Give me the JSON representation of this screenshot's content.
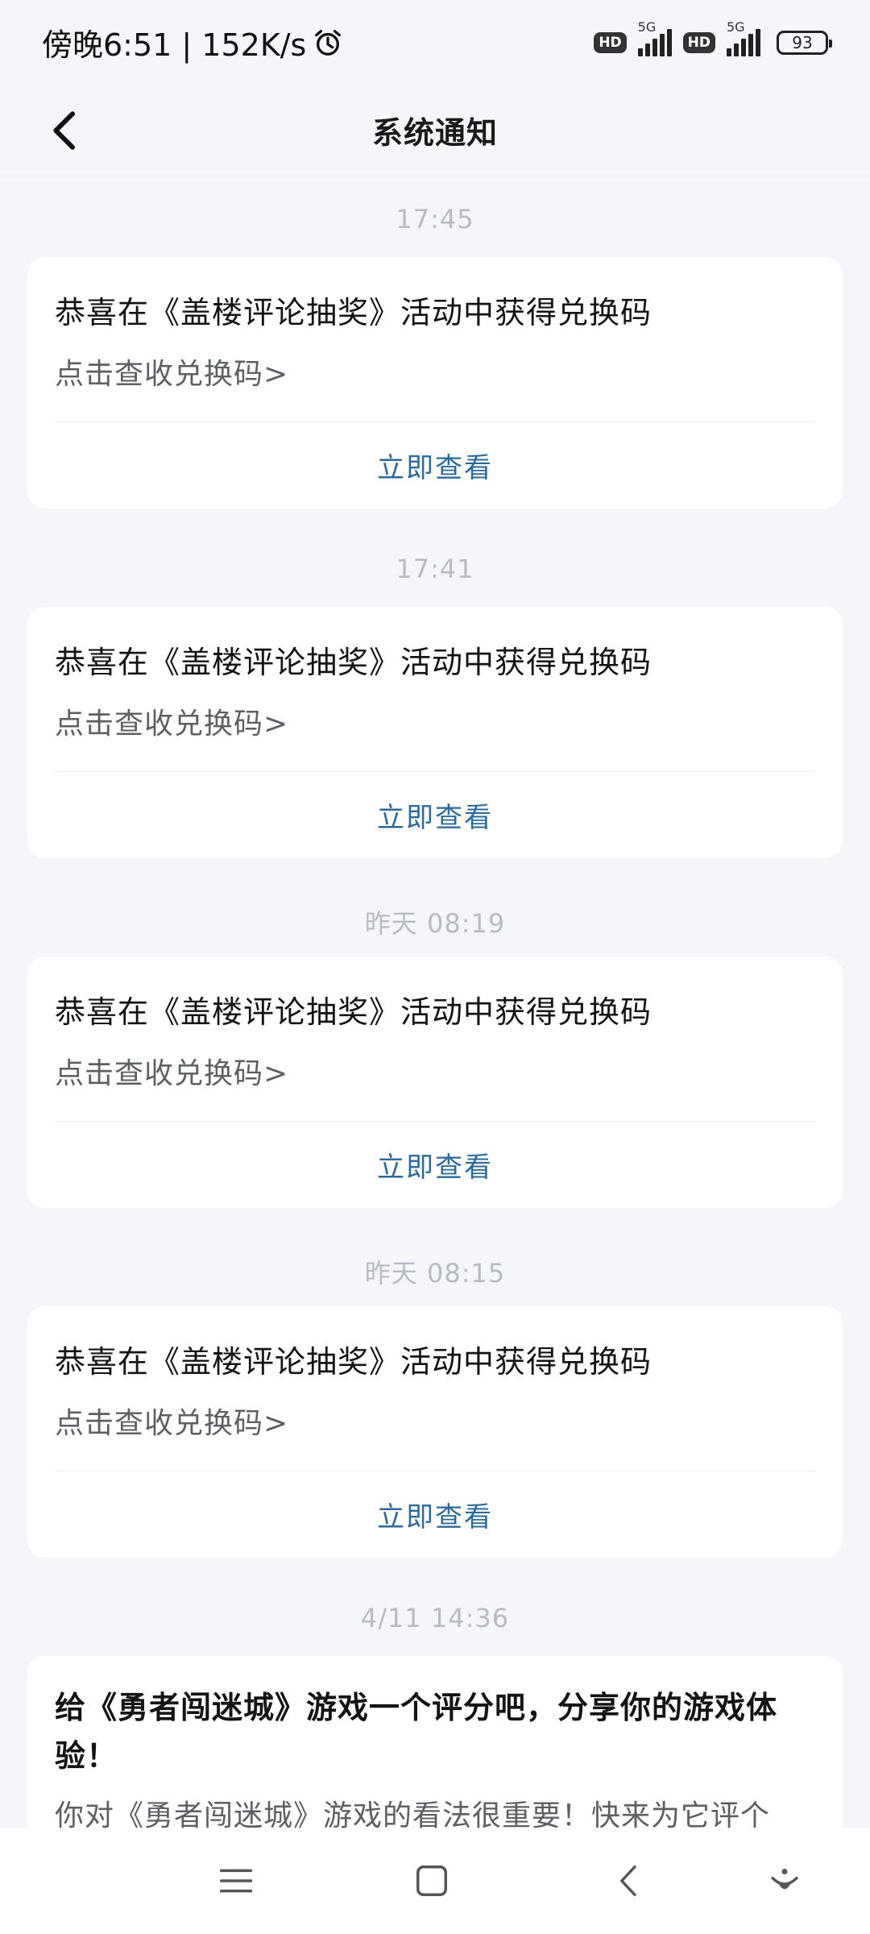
{
  "status_bar": {
    "time_text": "傍晚6:51 | 152K/s",
    "hd1": "HD",
    "net1": "5G",
    "hd2": "HD",
    "net2": "5G",
    "battery": "93"
  },
  "header": {
    "title": "系统通知"
  },
  "messages": [
    {
      "time": "17:45",
      "title": "恭喜在《盖楼评论抽奖》活动中获得兑换码",
      "subtitle": "点击查收兑换码>",
      "action": "立即查看"
    },
    {
      "time": "17:41",
      "title": "恭喜在《盖楼评论抽奖》活动中获得兑换码",
      "subtitle": "点击查收兑换码>",
      "action": "立即查看"
    },
    {
      "time": "昨天  08:19",
      "title": "恭喜在《盖楼评论抽奖》活动中获得兑换码",
      "subtitle": "点击查收兑换码>",
      "action": "立即查看"
    },
    {
      "time": "昨天  08:15",
      "title": "恭喜在《盖楼评论抽奖》活动中获得兑换码",
      "subtitle": "点击查收兑换码>",
      "action": "立即查看"
    },
    {
      "time": "4/11  14:36",
      "title": "给《勇者闯迷城》游戏一个评分吧，分享你的游戏体验！",
      "subtitle": "你对《勇者闯迷城》游戏的看法很重要！快来为它评个"
    }
  ],
  "colors": {
    "background": "#f4f6f9",
    "card": "#ffffff",
    "action": "#2d6a9c",
    "time": "#b8bcc2"
  },
  "icons": {
    "back": "chevron-left-icon",
    "alarm": "alarm-clock-icon",
    "nav_menu": "menu-icon",
    "nav_home": "square-home-icon",
    "nav_back": "chevron-left-icon",
    "nav_assist": "assistant-icon"
  }
}
